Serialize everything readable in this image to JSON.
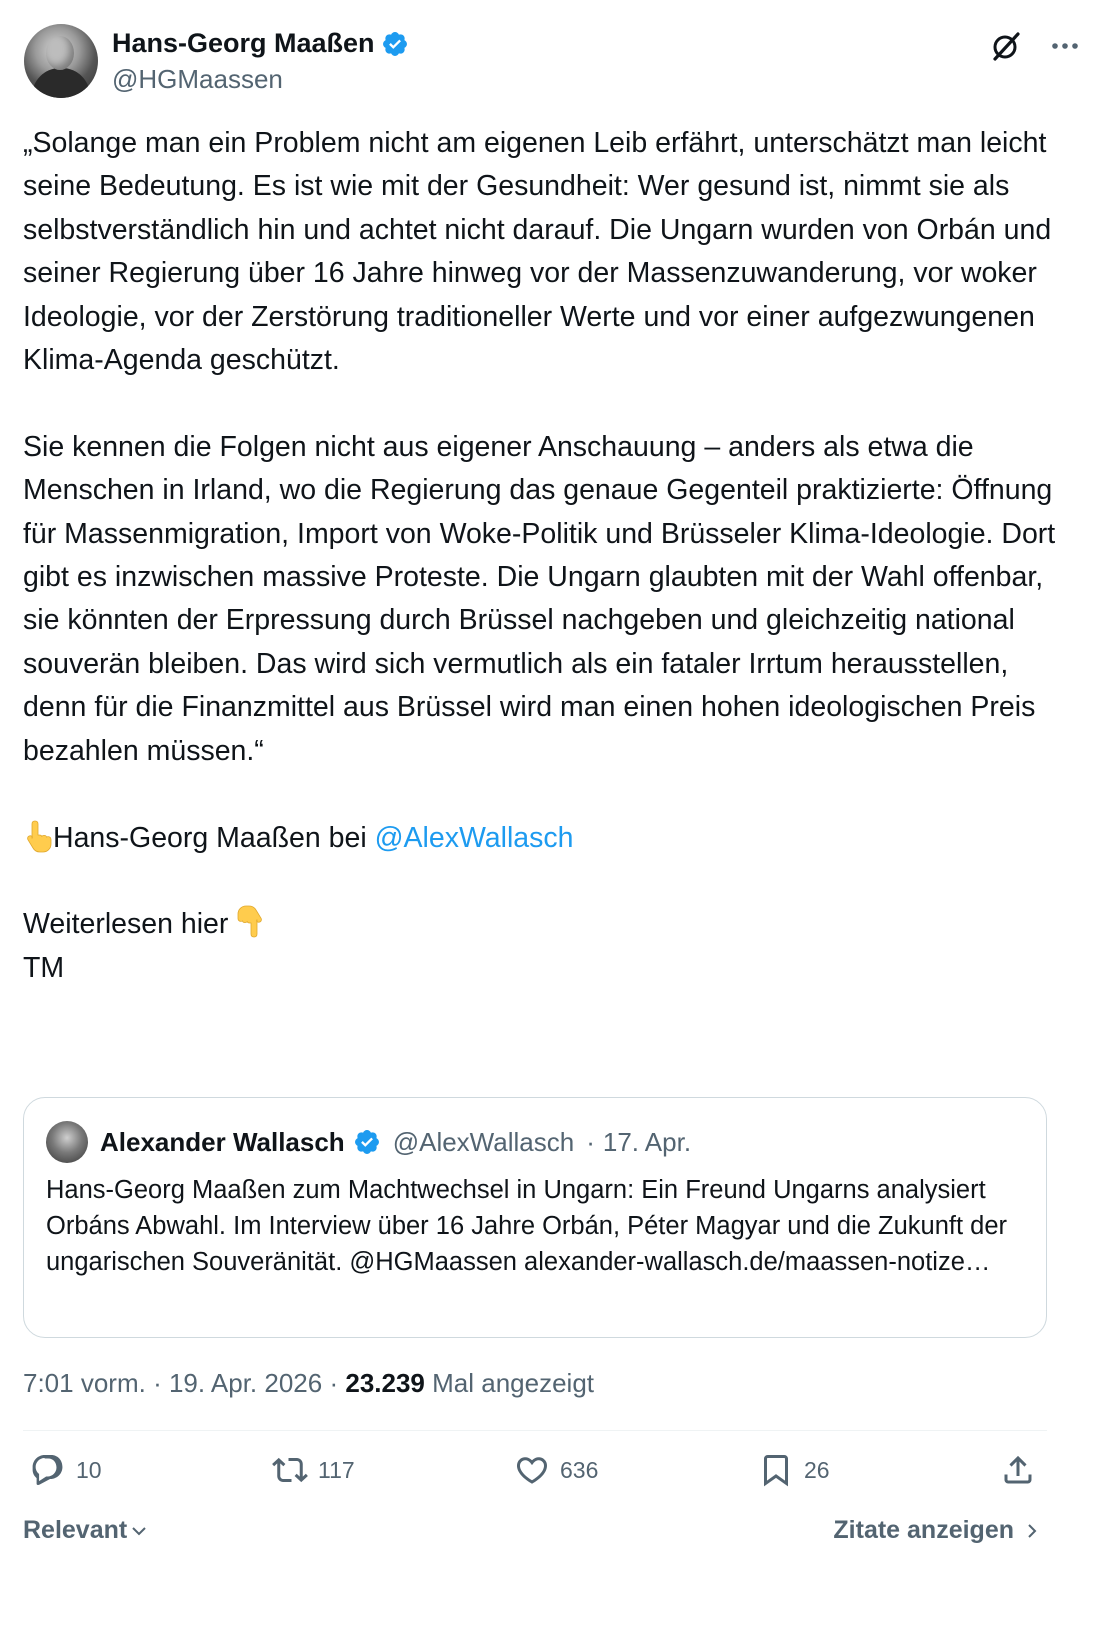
{
  "author": {
    "name": "Hans-Georg Maaßen",
    "handle": "@HGMaassen",
    "verified": true,
    "verified_color": "#1d9bf0"
  },
  "tweet": {
    "paragraph_1": "„Solange man ein Problem nicht am eigenen Leib erfährt, unterschätzt man leicht seine Bedeutung. Es ist wie mit der Gesundheit: Wer gesund ist, nimmt sie als selbstverständlich hin und achtet nicht darauf. Die Ungarn wurden von Orbán und seiner Regierung über 16 Jahre hinweg vor der Massenzuwanderung, vor woker Ideologie, vor der Zerstörung traditioneller Werte und vor einer aufgezwungenen Klima-Agenda geschützt.",
    "paragraph_2": "Sie kennen die Folgen nicht aus eigener Anschauung – anders als etwa die Menschen in Irland, wo die Regierung das genaue Gegenteil praktizierte: Öffnung für Massenmigration, Import von Woke-Politik und Brüsseler Klima-Ideologie. Dort gibt es inzwischen massive Proteste. Die Ungarn glaubten mit der Wahl offenbar, sie könnten der Erpressung durch Brüssel nachgeben und gleichzeitig national souverän bleiben. Das wird sich vermutlich als ein fataler Irrtum herausstellen, denn für die Finanzmittel aus Brüssel wird man einen hohen ideologischen Preis bezahlen müssen.“",
    "credit_prefix": "Hans-Georg Maaßen bei",
    "credit_mention": "@AlexWallasch",
    "read_more": "Weiterlesen hier",
    "signature": "TM",
    "emoji_up": "backhand-index-pointing-up",
    "emoji_down": "backhand-index-pointing-down"
  },
  "quote": {
    "name": "Alexander Wallasch",
    "handle": "@AlexWallasch",
    "separator": "·",
    "date": "17. Apr.",
    "text": "Hans-Georg Maaßen zum Machtwechsel in Ungarn: Ein Freund Ungarns analysiert Orbáns Abwahl. Im Interview über 16 Jahre Orbán, Péter Magyar und die Zukunft der ungarischen Souveränität. @HGMaassen alexander-wallasch.de/maassen-notize…"
  },
  "meta": {
    "time": "7:01 vorm.",
    "date": "19. Apr. 2026",
    "views": "23.239",
    "views_label": "Mal angezeigt",
    "sep": "·"
  },
  "actions": {
    "replies": "10",
    "reposts": "117",
    "likes": "636",
    "bookmarks": "26"
  },
  "footer": {
    "sort_label": "Relevant",
    "quotes_label": "Zitate anzeigen"
  },
  "colors": {
    "text": "#0f1419",
    "secondary": "#536471",
    "link": "#1d9bf0",
    "border": "#cfd9de"
  }
}
